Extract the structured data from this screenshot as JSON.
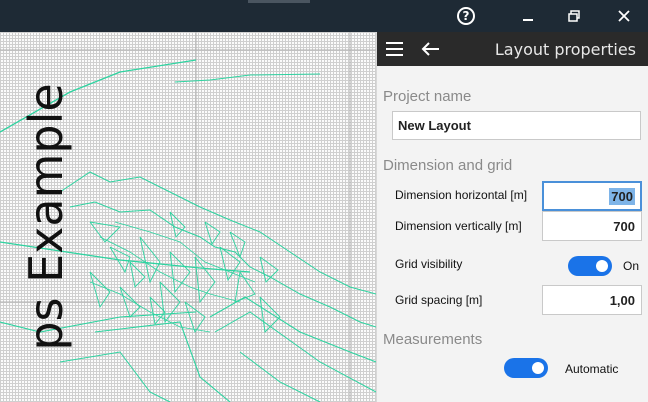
{
  "window": {
    "help_icon": "?",
    "minimize_icon": "‒",
    "maximize_icon": "❐",
    "close_icon": "✕"
  },
  "canvas": {
    "title": "ps Example",
    "line_color": "#2ed3a0"
  },
  "panel": {
    "title": "Layout properties",
    "project_section": "Project name",
    "project_name": "New Layout",
    "dimension_section": "Dimension and grid",
    "dim_horizontal_label": "Dimension horizontal [m]",
    "dim_horizontal_value": "700",
    "dim_vertical_label": "Dimension vertically [m]",
    "dim_vertical_value": "700",
    "grid_visibility_label": "Grid visibility",
    "grid_visibility_state": "On",
    "grid_spacing_label": "Grid spacing [m]",
    "grid_spacing_value": "1,00",
    "measurements_section": "Measurements",
    "measurements_state": "Automatic"
  },
  "colors": {
    "titlebar": "#1e2a35",
    "panel_header": "#2a2a2a",
    "toggle_on": "#1a73e8",
    "selection": "#7eb4e8"
  }
}
